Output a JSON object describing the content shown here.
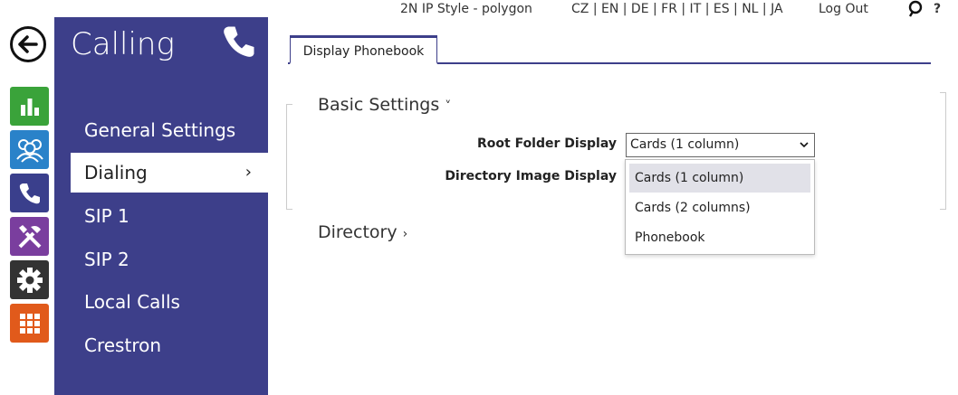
{
  "topbar": {
    "device_name": "2N IP Style - polygon",
    "languages": "CZ | EN | DE | FR | IT | ES | NL | JA",
    "logout": "Log Out",
    "help": "?"
  },
  "nav_icons": [
    "back-arrow-icon",
    "status-chart-icon",
    "users-icon",
    "phone-icon",
    "tools-icon",
    "gear-icon",
    "grid-icon"
  ],
  "sidebar": {
    "title": "Calling",
    "items": [
      {
        "label": "General Settings"
      },
      {
        "label": "Dialing",
        "chevron": "›"
      },
      {
        "label": "SIP 1"
      },
      {
        "label": "SIP 2"
      },
      {
        "label": "Local Calls"
      },
      {
        "label": "Crestron"
      }
    ]
  },
  "tabs": [
    {
      "label": "Display Phonebook"
    }
  ],
  "sections": {
    "basic": {
      "title": "Basic Settings",
      "arrow": "˅"
    },
    "directory": {
      "title": "Directory",
      "arrow": "›"
    }
  },
  "fields": {
    "root_folder": {
      "label": "Root Folder Display",
      "value": "Cards (1 column)"
    },
    "directory_image": {
      "label": "Directory Image Display"
    }
  },
  "dropdown": {
    "options": [
      "Cards (1 column)",
      "Cards (2 columns)",
      "Phonebook"
    ]
  },
  "colors": {
    "sidebar": "#3d3f8a",
    "status": "#3aa33a",
    "users": "#2a82c9",
    "calling": "#3a3f8c",
    "hardware": "#7a3e9e",
    "system": "#333333",
    "services": "#e15a1b"
  }
}
